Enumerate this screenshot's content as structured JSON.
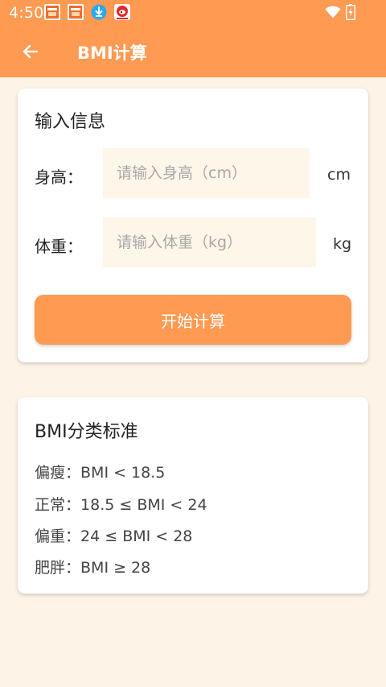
{
  "status_bar": {
    "time": "4:50",
    "notifications": [
      "store-icon",
      "store-icon",
      "download-icon",
      "weibo-icon"
    ],
    "wifi_icon": "wifi-icon",
    "battery_icon": "battery-charging-icon"
  },
  "app_bar": {
    "back_icon": "arrow-left-icon",
    "title": "BMI计算"
  },
  "input_card": {
    "title": "输入信息",
    "height_label": "身高：",
    "height_placeholder": "请输入身高（cm）",
    "height_value": "",
    "height_unit": "cm",
    "weight_label": "体重：",
    "weight_placeholder": "请输入体重（kg）",
    "weight_value": "",
    "weight_unit": "kg",
    "button_label": "开始计算"
  },
  "standard_card": {
    "title": "BMI分类标准",
    "items": [
      {
        "category": "偏瘦：",
        "range": "BMI < 18.5"
      },
      {
        "category": "正常：",
        "range": "18.5 ≤ BMI < 24"
      },
      {
        "category": "偏重：",
        "range": "24 ≤ BMI < 28"
      },
      {
        "category": "肥胖：",
        "range": "BMI ≥ 28"
      }
    ]
  },
  "colors": {
    "accent": "#fe9a52",
    "background": "#fdf3e6",
    "field_background": "#fff6ea",
    "card": "#ffffff"
  }
}
